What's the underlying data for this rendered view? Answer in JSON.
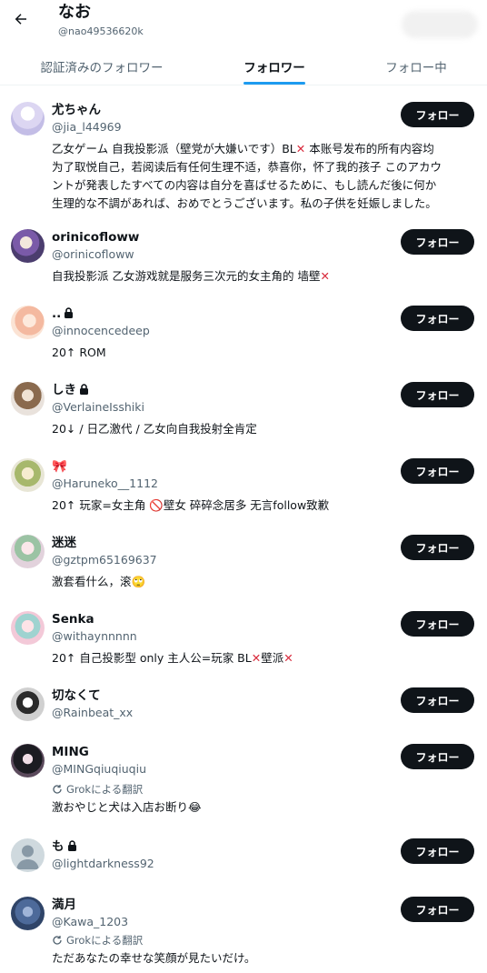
{
  "header": {
    "title": "なお",
    "handle": "@nao49536620k"
  },
  "tabs": [
    {
      "label": "認証済みのフォロワー",
      "active": false
    },
    {
      "label": "フォロワー",
      "active": true
    },
    {
      "label": "フォロー中",
      "active": false
    }
  ],
  "follow_label": "フォロー",
  "translate_label": "Grokによる翻訳",
  "colors": {
    "accent": "#1d9bf0",
    "button": "#0f1419",
    "secondary_text": "#536471"
  },
  "users": [
    {
      "name": "尤ちゃん",
      "handle": "@jia_l44969",
      "bio_lines": [
        "乙女ゲーム 自我投影派（壁党が大嫌いです）BL❌ 本账号发布的所有内容均",
        "为了取悦自己，若阅读后有任何生理不适，恭喜你，怀了我的孩子 このアカウ",
        "ントが発表したすべての内容は自分を喜ばせるために、もし読んだ後に何か",
        "生理的な不調があれば、おめでとうございます。私の子供を妊娠しました。"
      ]
    },
    {
      "name": "orinicofloww",
      "handle": "@orinicofloww",
      "bio_lines": [
        "自我投影派 乙女游戏就是服务三次元的女主角的 墙壁❌"
      ]
    },
    {
      "name": "..",
      "handle": "@innocencedeep",
      "locked": true,
      "bio_lines": [
        "20↑ ROM"
      ]
    },
    {
      "name": "しき",
      "handle": "@VerlaineIsshiki",
      "locked": true,
      "bio_lines": [
        "20↓ / 日乙激代 / 乙女向自我投射全肯定"
      ]
    },
    {
      "name": "🎀",
      "handle": "@Haruneko__1112",
      "bio_lines": [
        "20↑ 玩家=女主角 🚫壁女 碎碎念居多 无言follow致歉"
      ]
    },
    {
      "name": "迷迷",
      "handle": "@gztpm65169637",
      "bio_lines": [
        "激套看什么，滚🙄"
      ]
    },
    {
      "name": "Senka",
      "handle": "@withaynnnnn",
      "bio_lines": [
        "20↑ 自己投影型 only 主人公=玩家 BL❌壁派❌"
      ]
    },
    {
      "name": "切なくて",
      "handle": "@Rainbeat_xx",
      "bio_lines": []
    },
    {
      "name": "MING",
      "handle": "@MINGqiuqiuqiu",
      "translated": true,
      "bio_lines": [
        "激おやじと犬は入店お断り😂"
      ]
    },
    {
      "name": "も",
      "handle": "@lightdarkness92",
      "locked": true,
      "bio_lines": []
    },
    {
      "name": "満月",
      "handle": "@Kawa_1203",
      "translated": true,
      "bio_lines": [
        "ただあなたの幸せな笑顔が見たいだけ。"
      ]
    }
  ]
}
